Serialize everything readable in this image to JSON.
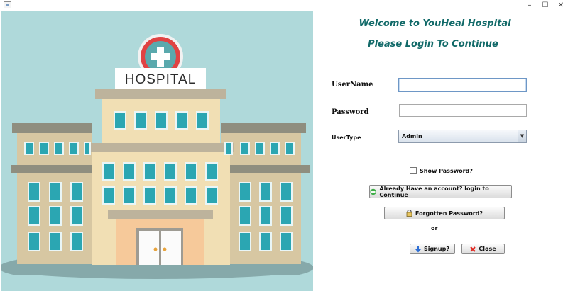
{
  "window": {
    "minimize_glyph": "–",
    "maximize_glyph": "☐",
    "close_glyph": "✕"
  },
  "illustration": {
    "sign_text": "HOSPITAL"
  },
  "header": {
    "welcome": "Welcome to YouHeal Hospital",
    "subtitle": "Please Login To Continue"
  },
  "form": {
    "username_label": "UserName",
    "username_value": "",
    "password_label": "Password",
    "password_value": "",
    "usertype_label": "UserType",
    "usertype_selected": "Admin",
    "show_password_label": "Show Password?",
    "show_password_checked": false
  },
  "buttons": {
    "login": "Already Have an account? login to Continue",
    "forgot": "Forgotten Password?",
    "or_text": "or",
    "signup": "Signup?",
    "close": "Close"
  },
  "colors": {
    "title": "#126a69",
    "illustration_background": "#afd9da"
  },
  "icons": {
    "login": "green-circle-icon",
    "forgot": "lock-icon",
    "signup": "down-arrow-icon",
    "close": "red-x-icon"
  }
}
